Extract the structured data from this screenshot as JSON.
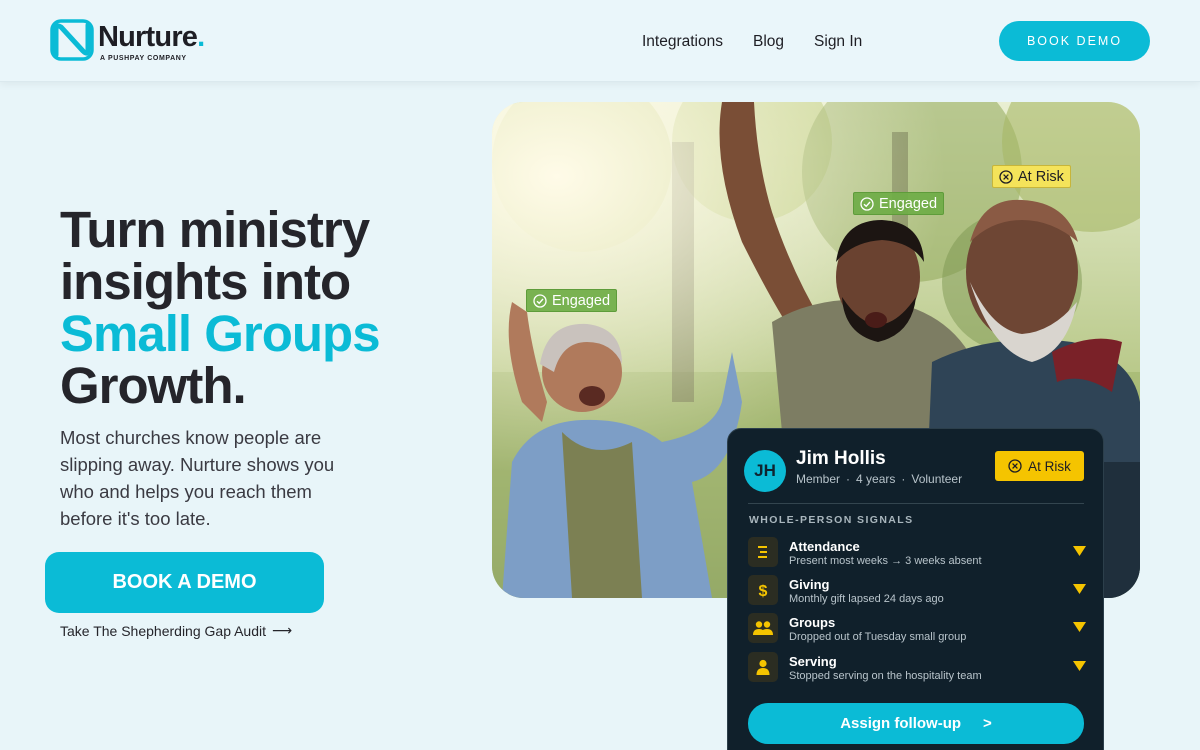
{
  "header": {
    "logo_word": "Nurture",
    "logo_dot": ".",
    "logo_sub": "A PUSHPAY COMPANY",
    "nav": [
      "Integrations",
      "Blog",
      "Sign In"
    ],
    "cta": "BOOK DEMO"
  },
  "hero": {
    "title_line1": "Turn ministry",
    "title_line2": "insights into",
    "title_accent": "Small Groups",
    "title_line4": "Growth.",
    "subtitle": "Most churches know people are slipping away. Nurture shows you who and helps you reach them before it's too late.",
    "cta": "BOOK A DEMO",
    "audit_link": "Take The Shepherding Gap Audit",
    "audit_arrow": "⟶"
  },
  "photo_tags": {
    "left": "Engaged",
    "middle": "Engaged",
    "right": "At Risk"
  },
  "profile_card": {
    "initials": "JH",
    "name": "Jim Hollis",
    "meta": [
      "Member",
      "·",
      "4 years",
      "·",
      "Volunteer"
    ],
    "status": "At Risk",
    "signals_title": "WHOLE-PERSON SIGNALS",
    "signals": [
      {
        "name": "Attendance",
        "desc": "Present most weeks → 3 weeks absent",
        "icon": "attendance-icon"
      },
      {
        "name": "Giving",
        "desc": "Monthly gift lapsed 24 days ago",
        "icon": "dollar-icon"
      },
      {
        "name": "Groups",
        "desc": "Dropped out of Tuesday small group",
        "icon": "group-icon"
      },
      {
        "name": "Serving",
        "desc": "Stopped serving on the hospitality team",
        "icon": "person-icon"
      }
    ],
    "action": "Assign follow-up",
    "action_chevron": ">"
  },
  "colors": {
    "brand": "#0bbbd6",
    "dark_card": "#10202b",
    "risk": "#f5c400",
    "engaged": "#6fac47"
  }
}
